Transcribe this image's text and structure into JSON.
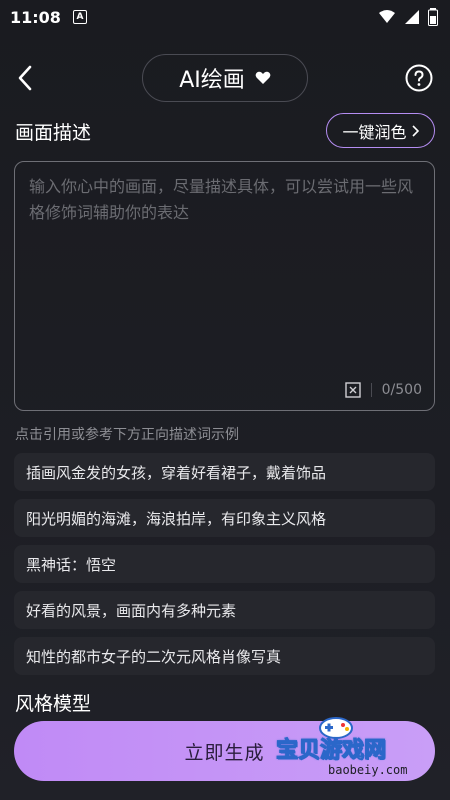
{
  "status": {
    "time": "11:08",
    "notif_badge": "A"
  },
  "header": {
    "title": "AI绘画"
  },
  "description": {
    "section_label": "画面描述",
    "polish_label": "一键润色",
    "placeholder": "输入你心中的画面，尽量描述具体，可以尝试用一些风格修饰词辅助你的表达",
    "counter": "0/500"
  },
  "examples_hint": "点击引用或参考下方正向描述词示例",
  "examples": [
    "插画风金发的女孩，穿着好看裙子，戴着饰品",
    "阳光明媚的海滩，海浪拍岸，有印象主义风格",
    "黑神话：悟空",
    "好看的风景，画面内有多种元素",
    "知性的都市女子的二次元风格肖像写真"
  ],
  "style_section_label": "风格模型",
  "generate_label": "立即生成",
  "watermark": {
    "brand": "宝贝游戏网",
    "url": "baobeiy.com"
  },
  "colors": {
    "accent": "#b58df2",
    "button": "#c08af6",
    "background": "#1b1c21"
  }
}
